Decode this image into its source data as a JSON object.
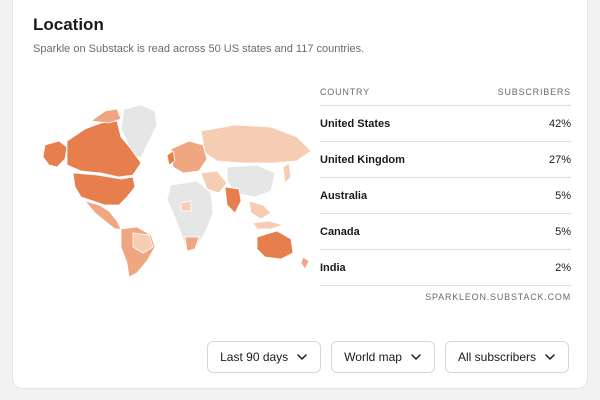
{
  "header": {
    "title": "Location",
    "subtitle": "Sparkle on Substack is read across 50 US states and 117 countries."
  },
  "table": {
    "col_country": "COUNTRY",
    "col_subscribers": "SUBSCRIBERS",
    "rows": [
      {
        "country": "United States",
        "share": "42%"
      },
      {
        "country": "United Kingdom",
        "share": "27%"
      },
      {
        "country": "Australia",
        "share": "5%"
      },
      {
        "country": "Canada",
        "share": "5%"
      },
      {
        "country": "India",
        "share": "2%"
      }
    ],
    "footer": "SPARKLEON.SUBSTACK.COM"
  },
  "controls": {
    "range_label": "Last 90 days",
    "view_label": "World map",
    "audience_label": "All subscribers"
  },
  "map": {
    "colors": {
      "high": "#e67e4d",
      "mid": "#f0a680",
      "low": "#f6cdb3",
      "none": "#e6e6e6"
    }
  }
}
